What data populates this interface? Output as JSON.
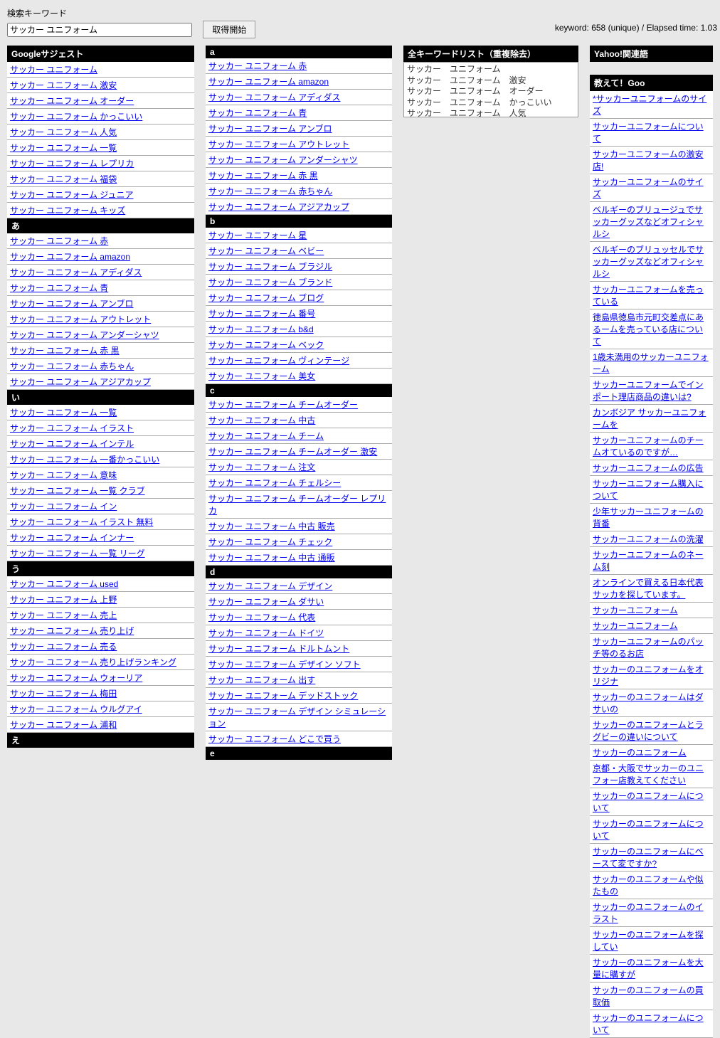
{
  "top": {
    "search_label": "検索キーワード",
    "search_value": "サッカー ユニフォーム",
    "fetch_button": "取得開始",
    "stats": "keyword: 658 (unique) / Elapsed time: 1.03"
  },
  "col1": {
    "header": "Googleサジェスト",
    "items_main": [
      "サッカー ユニフォーム",
      "サッカー ユニフォーム 激安",
      "サッカー ユニフォーム オーダー",
      "サッカー ユニフォーム かっこいい",
      "サッカー ユニフォーム 人気",
      "サッカー ユニフォーム 一覧",
      "サッカー ユニフォーム レプリカ",
      "サッカー ユニフォーム 福袋",
      "サッカー ユニフォーム ジュニア",
      "サッカー ユニフォーム キッズ"
    ],
    "sec_a": {
      "label": "あ",
      "items": [
        "サッカー ユニフォーム 赤",
        "サッカー ユニフォーム amazon",
        "サッカー ユニフォーム アディダス",
        "サッカー ユニフォーム 青",
        "サッカー ユニフォーム アンブロ",
        "サッカー ユニフォーム アウトレット",
        "サッカー ユニフォーム アンダーシャツ",
        "サッカー ユニフォーム 赤 黒",
        "サッカー ユニフォーム 赤ちゃん",
        "サッカー ユニフォーム アジアカップ"
      ]
    },
    "sec_i": {
      "label": "い",
      "items": [
        "サッカー ユニフォーム 一覧",
        "サッカー ユニフォーム イラスト",
        "サッカー ユニフォーム インテル",
        "サッカー ユニフォーム 一番かっこいい",
        "サッカー ユニフォーム 意味",
        "サッカー ユニフォーム 一覧 クラブ",
        "サッカー ユニフォーム イン",
        "サッカー ユニフォーム イラスト 無料",
        "サッカー ユニフォーム インナー",
        "サッカー ユニフォーム 一覧 リーグ"
      ]
    },
    "sec_u": {
      "label": "う",
      "items": [
        "サッカー ユニフォーム used",
        "サッカー ユニフォーム 上野",
        "サッカー ユニフォーム 売上",
        "サッカー ユニフォーム 売り上げ",
        "サッカー ユニフォーム 売る",
        "サッカー ユニフォーム 売り上げランキング",
        "サッカー ユニフォーム ウォーリア",
        "サッカー ユニフォーム 梅田",
        "サッカー ユニフォーム ウルグアイ",
        "サッカー ユニフォーム 浦和"
      ]
    },
    "sec_e": {
      "label": "え"
    }
  },
  "col2": {
    "sec_a": {
      "label": "a",
      "items": [
        "サッカー ユニフォーム 赤",
        "サッカー ユニフォーム amazon",
        "サッカー ユニフォーム アディダス",
        "サッカー ユニフォーム 青",
        "サッカー ユニフォーム アンブロ",
        "サッカー ユニフォーム アウトレット",
        "サッカー ユニフォーム アンダーシャツ",
        "サッカー ユニフォーム 赤 黒",
        "サッカー ユニフォーム 赤ちゃん",
        "サッカー ユニフォーム アジアカップ"
      ]
    },
    "sec_b": {
      "label": "b",
      "items": [
        "サッカー ユニフォーム 星",
        "サッカー ユニフォーム ベビー",
        "サッカー ユニフォーム ブラジル",
        "サッカー ユニフォーム ブランド",
        "サッカー ユニフォーム ブログ",
        "サッカー ユニフォーム 番号",
        "サッカー ユニフォーム b&d",
        "サッカー ユニフォーム ベック",
        "サッカー ユニフォーム ヴィンテージ",
        "サッカー ユニフォーム 美女"
      ]
    },
    "sec_c": {
      "label": "c",
      "items": [
        "サッカー ユニフォーム チームオーダー",
        "サッカー ユニフォーム 中古",
        "サッカー ユニフォーム チーム",
        "サッカー ユニフォーム チームオーダー 激安",
        "サッカー ユニフォーム 注文",
        "サッカー ユニフォーム チェルシー",
        "サッカー ユニフォーム チームオーダー レプリカ",
        "サッカー ユニフォーム 中古 販売",
        "サッカー ユニフォーム チェック",
        "サッカー ユニフォーム 中古 通販"
      ]
    },
    "sec_d": {
      "label": "d",
      "items": [
        "サッカー ユニフォーム デザイン",
        "サッカー ユニフォーム ダサい",
        "サッカー ユニフォーム 代表",
        "サッカー ユニフォーム ドイツ",
        "サッカー ユニフォーム ドルトムント",
        "サッカー ユニフォーム デザイン ソフト",
        "サッカー ユニフォーム 出す",
        "サッカー ユニフォーム デッドストック",
        "サッカー ユニフォーム デザイン シミュレーション",
        "サッカー ユニフォーム どこで買う"
      ]
    },
    "sec_e": {
      "label": "e"
    }
  },
  "col3": {
    "header": "全キーワードリスト（重複除去）",
    "lines": [
      "サッカー　ユニフォーム",
      "サッカー　ユニフォーム　激安",
      "サッカー　ユニフォーム　オーダー",
      "サッカー　ユニフォーム　かっこいい",
      "サッカー　ユニフォーム　人気"
    ]
  },
  "col4a": {
    "header": "Yahoo!関連語"
  },
  "col4b": {
    "header": "教えて！Goo",
    "items": [
      "*サッカーユニフォームのサイズ",
      "サッカーユニフォームについて",
      "サッカーユニフォームの激安店!",
      "サッカーユニフォームのサイズ",
      "ベルギーのブリュージュでサッカーグッズなどオフィシャルシ",
      "ベルギーのブリュッセルでサッカーグッズなどオフィシャルシ",
      "サッカーユニフォームを売っている",
      "徳島県徳島市元町交差点にあるームを売っている店について",
      "1歳未満用のサッカーユニフォーム",
      "サッカーユニフォームでインポート理店商品の違いは?",
      "カンボジア サッカーユニフォームを",
      "サッカーユニフォームのチームオているのですが…",
      "サッカーユニフォームの広告",
      "サッカーユニフォーム購入について",
      "少年サッカーユニフォームの背番",
      "サッカーユニフォームの洗濯",
      "サッカーユニフォームのネーム刻",
      "オンラインで買える日本代表サッカを探しています。",
      "サッカーユニフォーム",
      "サッカーユニフォーム",
      "サッカーユニフォームのパッチ等のるお店",
      "サッカーのユニフォームをオリジナ",
      "サッカーのユニフォームはダサいの",
      "サッカーのユニフォームとラグビーの違いについて",
      "サッカーのユニフォーム",
      "京都・大阪でサッカーのユニフォー店教えてください",
      "サッカーのユニフォームについて",
      "サッカーのユニフォームについて",
      "サッカーのユニフォームにベースて変ですか?",
      "サッカーのユニフォームや似たもの",
      "サッカーのユニフォームのイラスト",
      "サッカーのユニフォームを探してい",
      "サッカーのユニフォームを大量に購すが",
      "サッカーのユニフォームの買取価",
      "サッカーのユニフォームについて"
    ]
  }
}
